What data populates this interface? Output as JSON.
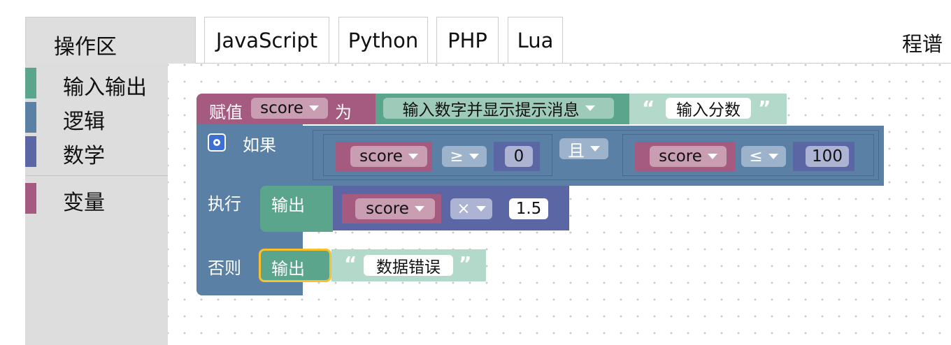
{
  "toolbox": {
    "title": "操作区",
    "categories": [
      {
        "label": "输入输出",
        "color": "#5ba58c"
      },
      {
        "label": "逻辑",
        "color": "#5b80a5"
      },
      {
        "label": "数学",
        "color": "#5b67a5"
      },
      {
        "label": "变量",
        "color": "#a55b80"
      }
    ]
  },
  "tabs": [
    {
      "label": "JavaScript"
    },
    {
      "label": "Python"
    },
    {
      "label": "PHP"
    },
    {
      "label": "Lua"
    }
  ],
  "corner_label": "程谱",
  "program": {
    "assign": {
      "keyword": "赋值",
      "variable": "score",
      "to": "为",
      "input_block": "输入数字并显示提示消息",
      "prompt_text": "输入分数"
    },
    "if_block": {
      "if_label": "如果",
      "do_label": "执行",
      "else_label": "否则",
      "condition": {
        "left": {
          "variable": "score",
          "operator": "≥",
          "value": "0"
        },
        "logic_operator": "且",
        "right": {
          "variable": "score",
          "operator": "≤",
          "value": "100"
        }
      },
      "then_output": {
        "label": "输出",
        "variable": "score",
        "operator": "×",
        "value": "1.5"
      },
      "else_output": {
        "label": "输出",
        "text": "数据错误"
      }
    }
  },
  "colors": {
    "variable_block": "#a55b80",
    "text_block": "#5ba58c",
    "logic_block": "#5b80a5",
    "math_block": "#5b67a5",
    "selection": "#fbc02d"
  }
}
